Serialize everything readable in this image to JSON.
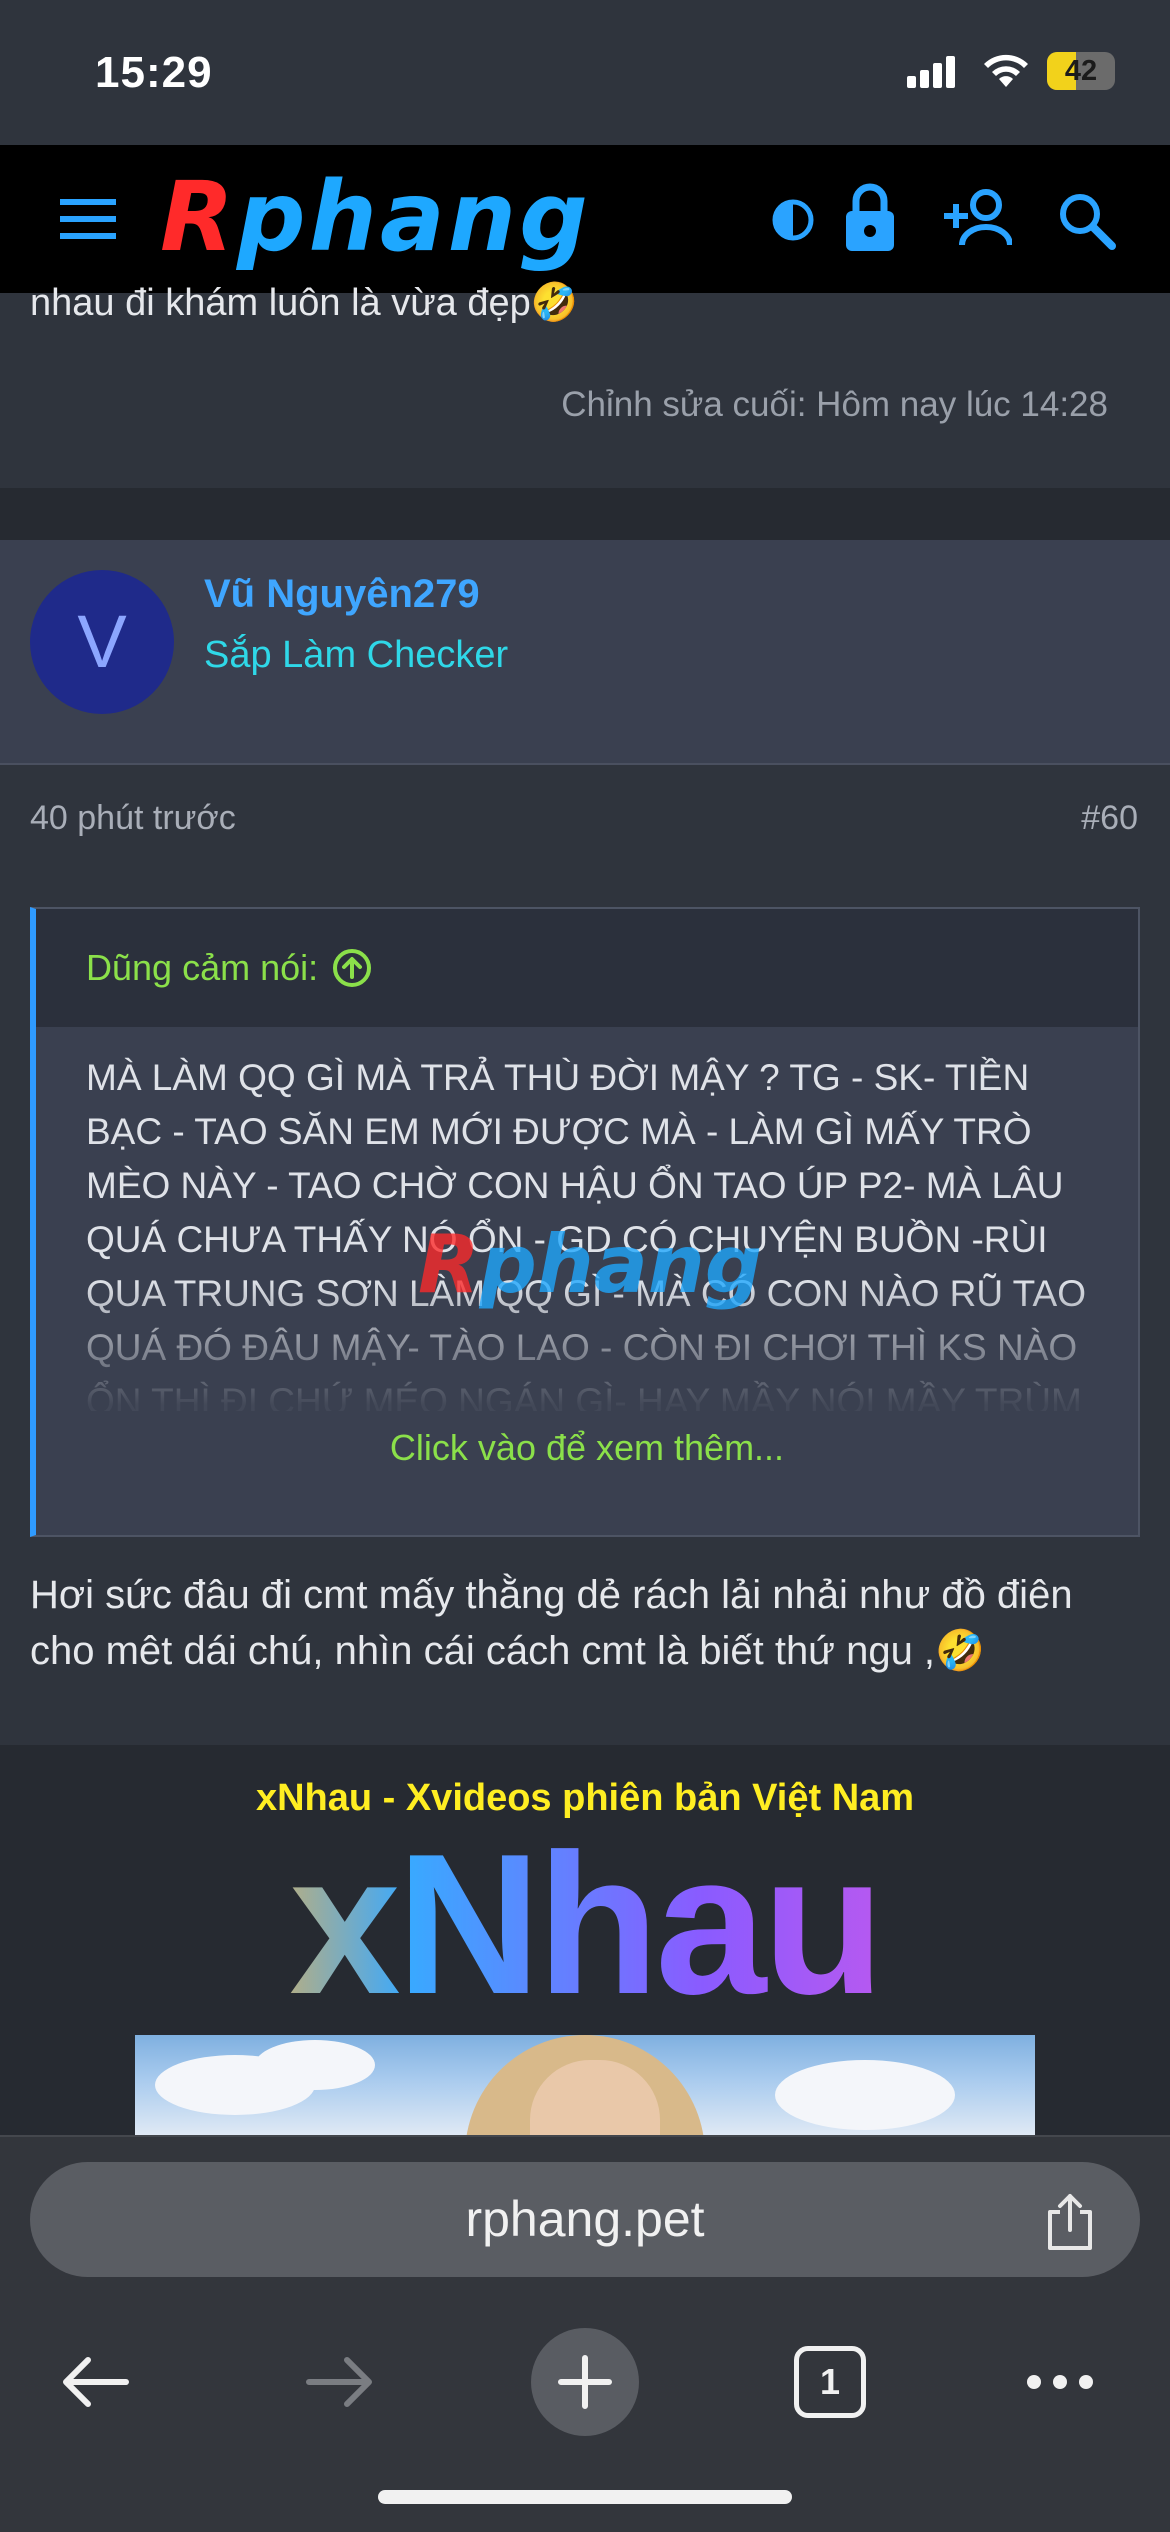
{
  "status_bar": {
    "time": "15:29",
    "battery": "42",
    "battery_level": 0.42
  },
  "header": {
    "logo_first": "R",
    "logo_rest": "phang",
    "icons": [
      "menu-icon",
      "theme-toggle-icon",
      "lock-icon",
      "add-user-icon",
      "search-icon"
    ]
  },
  "previous_post": {
    "tail_text": "nhau đi khám luôn là vừa đẹp🤣",
    "edited": "Chỉnh sửa cuối: Hôm nay lúc 14:28"
  },
  "post": {
    "avatar_letter": "V",
    "username": "Vũ Nguyên279",
    "user_title": "Sắp Làm Checker",
    "time": "40 phút trước",
    "number": "#60",
    "quote": {
      "author": "Dũng cảm nói:",
      "text": "MÀ LÀM QQ GÌ MÀ TRẢ THÙ ĐỜI MẬY ? TG - SK- TIỀN BẠC - TAO SĂN EM MỚI ĐƯỢC MÀ - LÀM GÌ MẤY TRÒ MÈO NÀY - TAO CHỜ CON HẬU ỔN TAO ÚP P2- MÀ LÂU QUÁ CHƯA THẤY NÓ ỔN - GD CÓ CHUYỆN BUỒN -RÙI QUA TRUNG SƠN LÀM QQ GÌ - MÀ CÓ CON NÀO RŨ TAO QUÁ ĐÓ ĐÂU MẬY- TÀO LAO - CÒN ĐI CHƠI THÌ KS NÀO ỔN THÌ ĐI CHỨ MÉO NGÁN GÌ- HAY MẦY NÓI MẦY TRÙM",
      "more": "Click vào để xem thêm..."
    },
    "reply": "Hơi sức đâu đi cmt mấy thằng dẻ rách lải nhải như đồ điên cho mêt dái chú, nhìn cái cách cmt là biết thứ ngu ,🤣"
  },
  "watermark": {
    "first": "R",
    "rest": "phang"
  },
  "ad": {
    "title": "xNhau - Xvideos phiên bản Việt Nam",
    "logo": "xNhau"
  },
  "browser": {
    "url": "rphang.pet",
    "tab_count": "1",
    "icons": [
      "back-icon",
      "forward-icon",
      "new-tab-icon",
      "tabs-icon",
      "more-icon",
      "share-icon"
    ]
  },
  "colors": {
    "accent": "#2f9bff",
    "quote_author": "#8be04a",
    "username": "#3fa6ff",
    "user_title": "#2fd8e8",
    "ad_title": "#ffee22"
  }
}
